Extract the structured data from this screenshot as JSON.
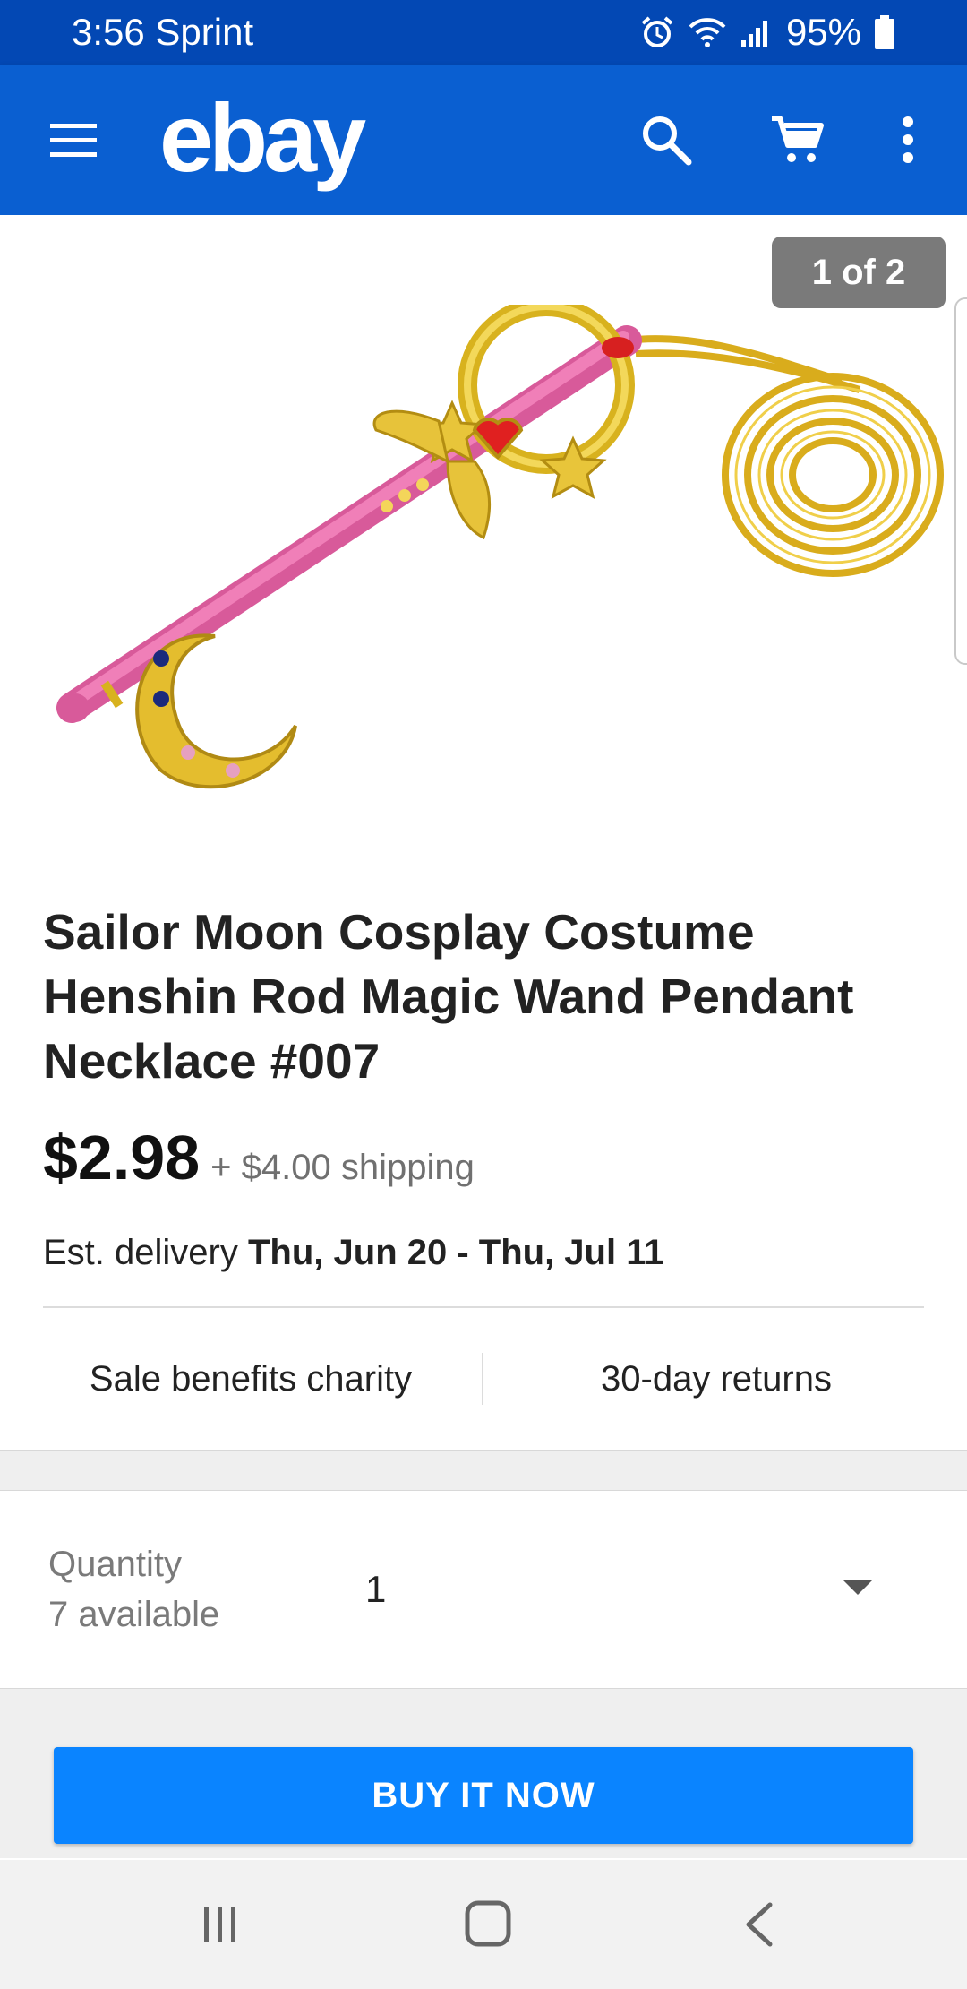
{
  "status_bar": {
    "time_carrier": "3:56 Sprint",
    "battery_percent": "95%",
    "icons": [
      "alarm-icon",
      "wifi-icon",
      "signal-icon",
      "battery-icon"
    ]
  },
  "app_bar": {
    "logo": "ebay",
    "icons": [
      "menu-icon",
      "search-icon",
      "cart-icon",
      "more-vert-icon"
    ],
    "color": "#0a5fd1"
  },
  "gallery": {
    "counter": "1 of 2"
  },
  "product": {
    "title": "Sailor Moon Cosplay Costume Henshin Rod Magic Wand Pendant Necklace #007",
    "price": "$2.98",
    "shipping": "+ $4.00 shipping",
    "delivery_prefix": "Est. delivery",
    "delivery_dates": "Thu, Jun 20 - Thu, Jul 11"
  },
  "features": {
    "charity": "Sale benefits charity",
    "returns": "30-day returns"
  },
  "quantity": {
    "label": "Quantity",
    "available": "7 available",
    "selected": "1"
  },
  "actions": {
    "buy_now": "BUY IT NOW",
    "buy_color": "#0a84ff"
  },
  "nav": {
    "icons": [
      "recents-icon",
      "home-icon",
      "back-icon"
    ]
  }
}
